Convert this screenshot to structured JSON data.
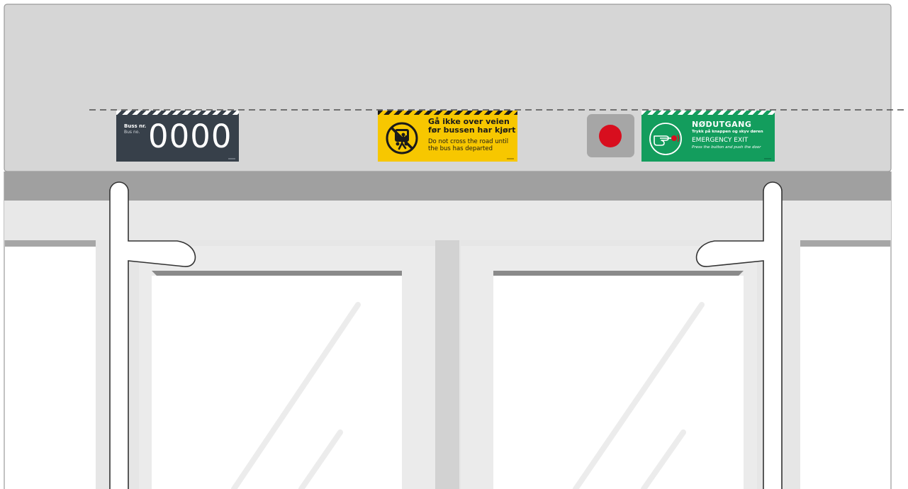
{
  "bus_sign": {
    "label_no": "Buss nr.",
    "label_en": "Bus no.",
    "number": "0000"
  },
  "warning_sign": {
    "line1_no": "Gå ikke over veien",
    "line2_no": "før bussen har kjørt",
    "line1_en": "Do not cross the road until",
    "line2_en": "the bus has departed",
    "icon": "no-crossing-pedestrian-bus-icon"
  },
  "emergency_button": {
    "icon": "red-push-button-icon"
  },
  "exit_sign": {
    "title_no": "NØDUTGANG",
    "instruction_no": "Trykk på knappen og skyv døren",
    "title_en": "EMERGENCY EXIT",
    "instruction_en": "Press the button and push the door",
    "icon": "hand-press-button-icon"
  },
  "colors": {
    "bus_sign_bg": "#37404a",
    "warning_bg": "#f7c700",
    "exit_bg": "#139d5d",
    "button_red": "#d80e1e",
    "panel_gray": "#d6d6d6",
    "rail_gray": "#a0a0a0"
  }
}
